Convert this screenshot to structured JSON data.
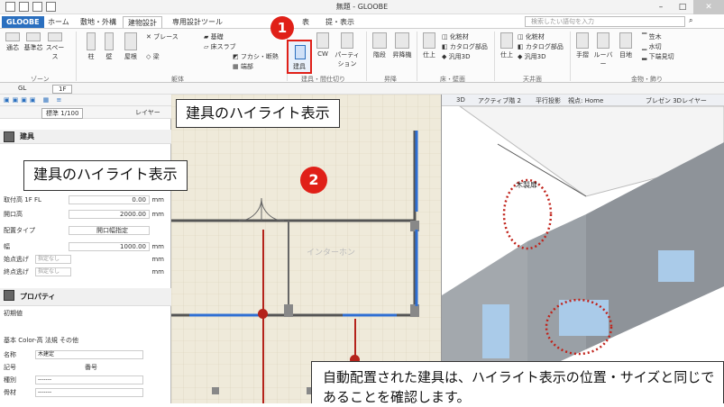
{
  "window": {
    "title": "無題 - GLOOBE"
  },
  "ribbon_tabs": [
    {
      "label": "GLOOBE",
      "app": true
    },
    {
      "label": "ホーム"
    },
    {
      "label": "敷地・外構"
    },
    {
      "label": "建物設計",
      "active": true
    },
    {
      "label": "専用設計ツール"
    },
    {
      "label": "表"
    },
    {
      "label": "提・表示"
    }
  ],
  "search": {
    "placeholder": "検索したい語句を入力"
  },
  "ribbon": {
    "buttons": [
      {
        "label": "通芯",
        "icon": "grid-axis-icon"
      },
      {
        "label": "基準芯",
        "icon": "base-axis-icon"
      },
      {
        "label": "スペース",
        "icon": "space-icon"
      },
      {
        "label": "柱",
        "icon": "column-icon"
      },
      {
        "label": "壁",
        "icon": "wall-icon"
      },
      {
        "label": "屋根",
        "icon": "roof-icon"
      },
      {
        "label": "ブレース",
        "icon": "brace-icon"
      },
      {
        "label": "梁",
        "icon": "beam-icon"
      },
      {
        "label": "基礎",
        "icon": "foundation-icon"
      },
      {
        "label": "床スラブ",
        "icon": "floor-slab-icon"
      },
      {
        "label": "フカシ・断熱",
        "icon": "insulation-icon"
      },
      {
        "label": "端部",
        "icon": "end-icon"
      },
      {
        "label": "CW",
        "icon": "curtain-wall-icon"
      },
      {
        "label": "パーティション",
        "icon": "partition-icon"
      },
      {
        "label": "階段",
        "icon": "stairs-icon"
      },
      {
        "label": "昇降機",
        "icon": "elevator-icon"
      },
      {
        "label": "仕上",
        "icon": "finish-icon"
      },
      {
        "label": "化粧材",
        "icon": "trim-icon"
      },
      {
        "label": "カタログ部品",
        "icon": "catalog-icon"
      },
      {
        "label": "汎用3D",
        "icon": "generic-3d-icon"
      },
      {
        "label": "仕上",
        "icon": "finish-icon"
      },
      {
        "label": "化粧材",
        "icon": "trim-icon"
      },
      {
        "label": "カタログ部品",
        "icon": "catalog-icon"
      },
      {
        "label": "汎用3D",
        "icon": "generic-3d-icon"
      },
      {
        "label": "手摺",
        "icon": "handrail-icon"
      },
      {
        "label": "ルーバー",
        "icon": "louver-icon"
      },
      {
        "label": "目地",
        "icon": "joint-icon"
      },
      {
        "label": "笠木",
        "icon": "coping-icon"
      },
      {
        "label": "水切",
        "icon": "drip-icon"
      },
      {
        "label": "下端見切",
        "icon": "bottom-trim-icon"
      }
    ],
    "tategu_label": "建具",
    "groups": [
      "ゾーン",
      "躯体",
      "建具・間仕切り",
      "昇降",
      "床・壁面",
      "天井面",
      "金物・飾り"
    ]
  },
  "toolbar": {
    "floor": "1F",
    "gl": "GL",
    "scale": "標準 1/100",
    "layer": "レイヤー",
    "view3d_tabs": [
      "3D",
      "アクティブ階 2",
      "平行投影",
      "視点: Home",
      "ブレゼン 3Dレイヤー"
    ]
  },
  "panel": {
    "title": "建具",
    "rows": [
      {
        "label": "取付高",
        "sub": "1F FL",
        "value": "0.00",
        "unit": "mm"
      },
      {
        "label": "開口高",
        "value": "2000.00",
        "unit": "mm"
      },
      {
        "label": "配置タイプ",
        "value": "開口幅指定"
      },
      {
        "label": "幅",
        "value": "1000.00",
        "unit": "mm"
      },
      {
        "label": "始点逃げ",
        "placeholder": "指定なし",
        "unit": "mm"
      },
      {
        "label": "終点逃げ",
        "placeholder": "指定なし",
        "unit": "mm"
      }
    ],
    "property_title": "プロパティ",
    "initial": "初期値",
    "tabs": [
      "基本",
      "Color-高",
      "法規",
      "その他"
    ],
    "fields": [
      {
        "label": "名称",
        "value": "木建定"
      },
      {
        "label": "記号",
        "value": "",
        "label2": "番号"
      },
      {
        "label": "種別",
        "value": "-------"
      },
      {
        "label": "骨材",
        "value": "-------"
      }
    ]
  },
  "canvas": {
    "watermark": "インターホン",
    "door_label": "木製扉"
  },
  "callouts": {
    "top": "建具のハイライト表示",
    "left": "建具のハイライト表示",
    "badge1": "1",
    "badge2": "2",
    "note": "自動配置された建具は、ハイライト表示の位置・サイズと同じであることを確認します。"
  },
  "colors": {
    "accent_red": "#e02018",
    "highlight_blue": "#2f6fd3",
    "brand_blue": "#2a6fbf"
  }
}
